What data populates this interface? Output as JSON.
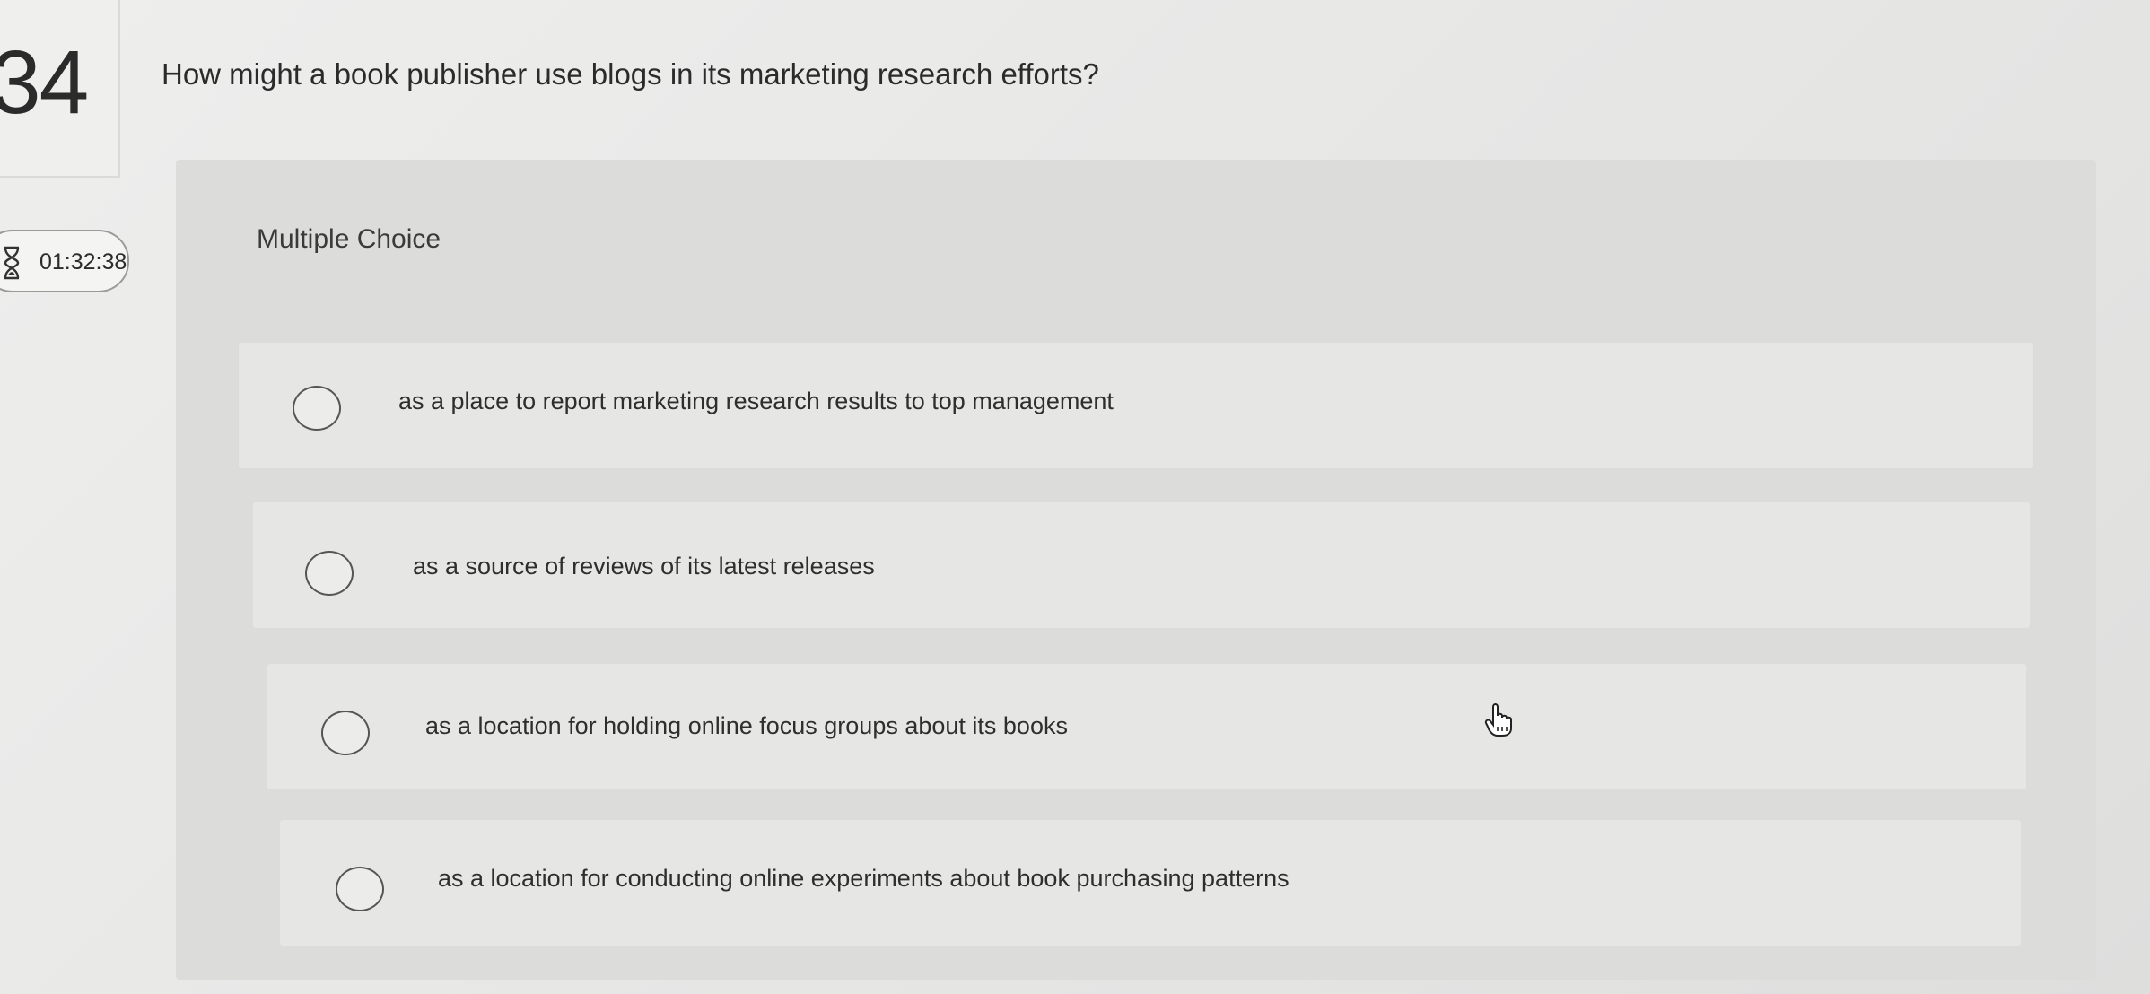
{
  "question": {
    "number": "34",
    "text": "How might a book publisher use blogs in its marketing research efforts?"
  },
  "timer": {
    "value": "01:32:38",
    "icon": "hourglass-icon"
  },
  "question_type": "Multiple Choice",
  "options": [
    {
      "label": "as a place to report marketing research results to top management",
      "selected": false
    },
    {
      "label": "as a source of reviews of its latest releases",
      "selected": false
    },
    {
      "label": "as a location for holding online focus groups about its books",
      "selected": false
    },
    {
      "label": "as a location for conducting online experiments about book purchasing patterns",
      "selected": false
    }
  ],
  "cursor": {
    "icon": "hand-pointer-icon"
  }
}
